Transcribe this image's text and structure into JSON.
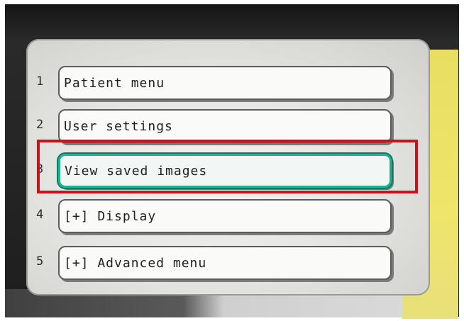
{
  "menu": {
    "items": [
      {
        "number": "1",
        "label": "Patient menu"
      },
      {
        "number": "2",
        "label": "User settings"
      },
      {
        "number": "3",
        "label": "View saved images"
      },
      {
        "number": "4",
        "label": "[+] Display"
      },
      {
        "number": "5",
        "label": "[+] Advanced menu"
      }
    ],
    "selected_index": 2
  },
  "colors": {
    "selection_border": "#1fb28f",
    "highlight_annotation": "#c5141b",
    "panel_background": "#e6e6e3",
    "side_panel": "#eee56a"
  }
}
